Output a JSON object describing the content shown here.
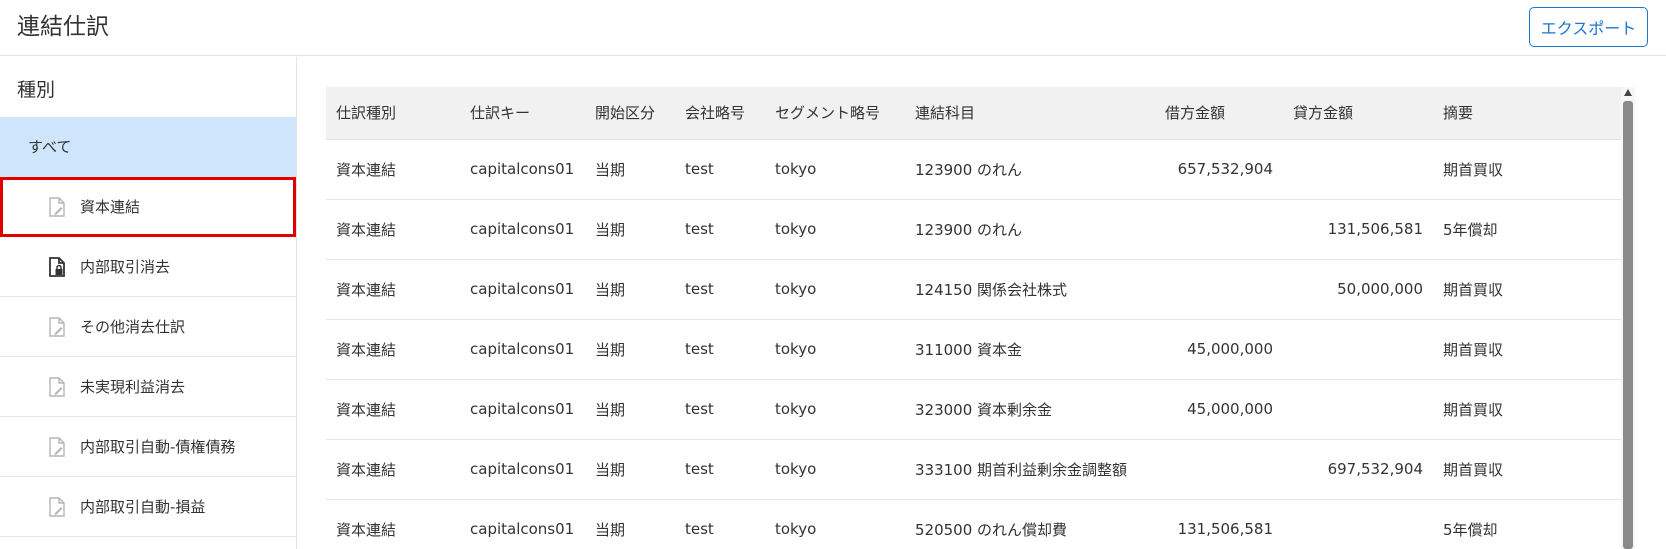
{
  "header": {
    "title": "連結仕訳",
    "export_label": "エクスポート"
  },
  "sidebar": {
    "heading": "種別",
    "items": [
      {
        "label": "すべて",
        "icon": ""
      },
      {
        "label": "資本連結",
        "icon": "document-edit-icon"
      },
      {
        "label": "内部取引消去",
        "icon": "document-lock-icon"
      },
      {
        "label": "その他消去仕訳",
        "icon": "document-edit-icon"
      },
      {
        "label": "未実現利益消去",
        "icon": "document-edit-icon"
      },
      {
        "label": "内部取引自動-債権債務",
        "icon": "document-edit-icon"
      },
      {
        "label": "内部取引自動-損益",
        "icon": "document-edit-icon"
      }
    ]
  },
  "table": {
    "columns": [
      "仕訳種別",
      "仕訳キー",
      "開始区分",
      "会社略号",
      "セグメント略号",
      "連結科目",
      "借方金額",
      "貸方金額",
      "摘要"
    ],
    "rows": [
      [
        "資本連結",
        "capitalcons01",
        "当期",
        "test",
        "tokyo",
        "123900 のれん",
        "657,532,904",
        "",
        "期首買収"
      ],
      [
        "資本連結",
        "capitalcons01",
        "当期",
        "test",
        "tokyo",
        "123900 のれん",
        "",
        "131,506,581",
        "5年償却"
      ],
      [
        "資本連結",
        "capitalcons01",
        "当期",
        "test",
        "tokyo",
        "124150 関係会社株式",
        "",
        "50,000,000",
        "期首買収"
      ],
      [
        "資本連結",
        "capitalcons01",
        "当期",
        "test",
        "tokyo",
        "311000 資本金",
        "45,000,000",
        "",
        "期首買収"
      ],
      [
        "資本連結",
        "capitalcons01",
        "当期",
        "test",
        "tokyo",
        "323000 資本剰余金",
        "45,000,000",
        "",
        "期首買収"
      ],
      [
        "資本連結",
        "capitalcons01",
        "当期",
        "test",
        "tokyo",
        "333100 期首利益剰余金調整額",
        "",
        "697,532,904",
        "期首買収"
      ],
      [
        "資本連結",
        "capitalcons01",
        "当期",
        "test",
        "tokyo",
        "520500 のれん償却費",
        "131,506,581",
        "",
        "5年償却"
      ]
    ]
  },
  "colors": {
    "accent": "#1976d2",
    "selected_bg": "#cfe5fb",
    "highlight_border": "#e00000"
  }
}
